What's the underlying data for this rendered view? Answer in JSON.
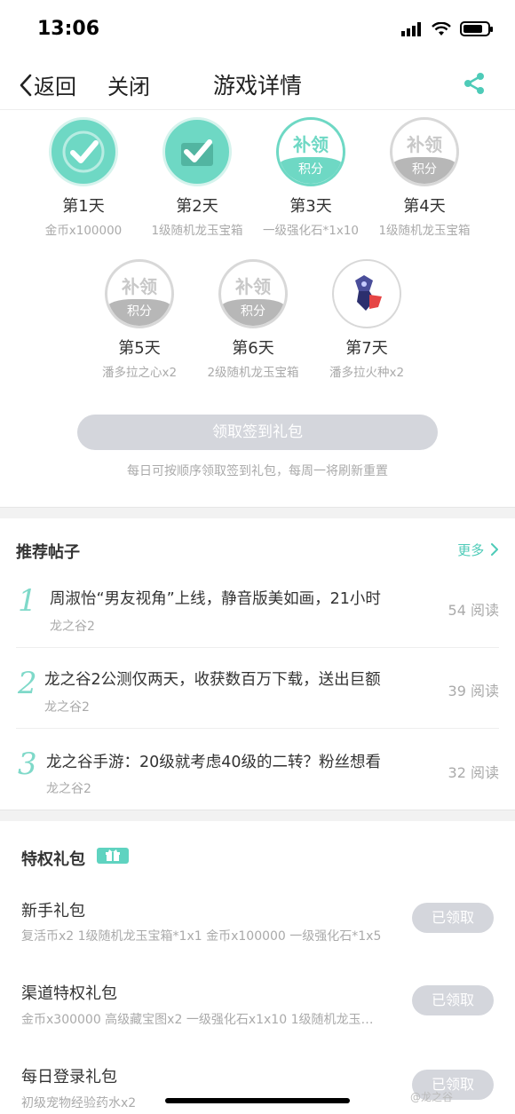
{
  "status": {
    "time": "13:06",
    "battery_level": 0.8
  },
  "nav": {
    "back": "返回",
    "close": "关闭",
    "title": "游戏详情"
  },
  "signin": {
    "days": [
      {
        "label": "第1天",
        "reward": "金币x100000",
        "state": "done",
        "icon": "checkmark-icon"
      },
      {
        "label": "第2天",
        "reward": "1级随机龙玉宝箱",
        "state": "done",
        "icon": "checkmark-icon"
      },
      {
        "label": "第3天",
        "reward": "一级强化石*1x10",
        "state": "makeup-green",
        "makeup_top": "补领",
        "makeup_bottom": "积分"
      },
      {
        "label": "第4天",
        "reward": "1级随机龙玉宝箱",
        "state": "makeup-gray",
        "makeup_top": "补领",
        "makeup_bottom": "积分"
      },
      {
        "label": "第5天",
        "reward": "潘多拉之心x2",
        "state": "makeup-gray",
        "makeup_top": "补领",
        "makeup_bottom": "积分"
      },
      {
        "label": "第6天",
        "reward": "2级随机龙玉宝箱",
        "state": "makeup-gray",
        "makeup_top": "补领",
        "makeup_bottom": "积分"
      },
      {
        "label": "第7天",
        "reward": "潘多拉火种x2",
        "state": "locked",
        "icon": "pandora-fire-icon"
      }
    ],
    "claim_button": "领取签到礼包",
    "note": "每日可按顺序领取签到礼包，每周一将刷新重置"
  },
  "posts": {
    "title": "推荐帖子",
    "more": "更多",
    "items": [
      {
        "rank": "1",
        "title": "周淑怡“男友视角”上线，静音版美如画，21小时",
        "source": "龙之谷2",
        "reads": "54 阅读"
      },
      {
        "rank": "2",
        "title": "龙之谷2公测仅两天，收获数百万下载，送出巨额",
        "source": "龙之谷2",
        "reads": "39 阅读"
      },
      {
        "rank": "3",
        "title": "龙之谷手游：20级就考虑40级的二转？粉丝想看",
        "source": "龙之谷2",
        "reads": "32 阅读"
      }
    ]
  },
  "packages": {
    "title": "特权礼包",
    "items": [
      {
        "name": "新手礼包",
        "desc": "复活币x2 1级随机龙玉宝箱*1x1 金币x100000 一级强化石*1x5",
        "button": "已领取"
      },
      {
        "name": "渠道特权礼包",
        "desc": "金币x300000 高级藏宝图x2 一级强化石x1x10 1级随机龙玉…",
        "button": "已领取"
      },
      {
        "name": "每日登录礼包",
        "desc": "初级宠物经验药水x2",
        "button": "已领取"
      }
    ]
  },
  "watermark": "@龙之谷"
}
